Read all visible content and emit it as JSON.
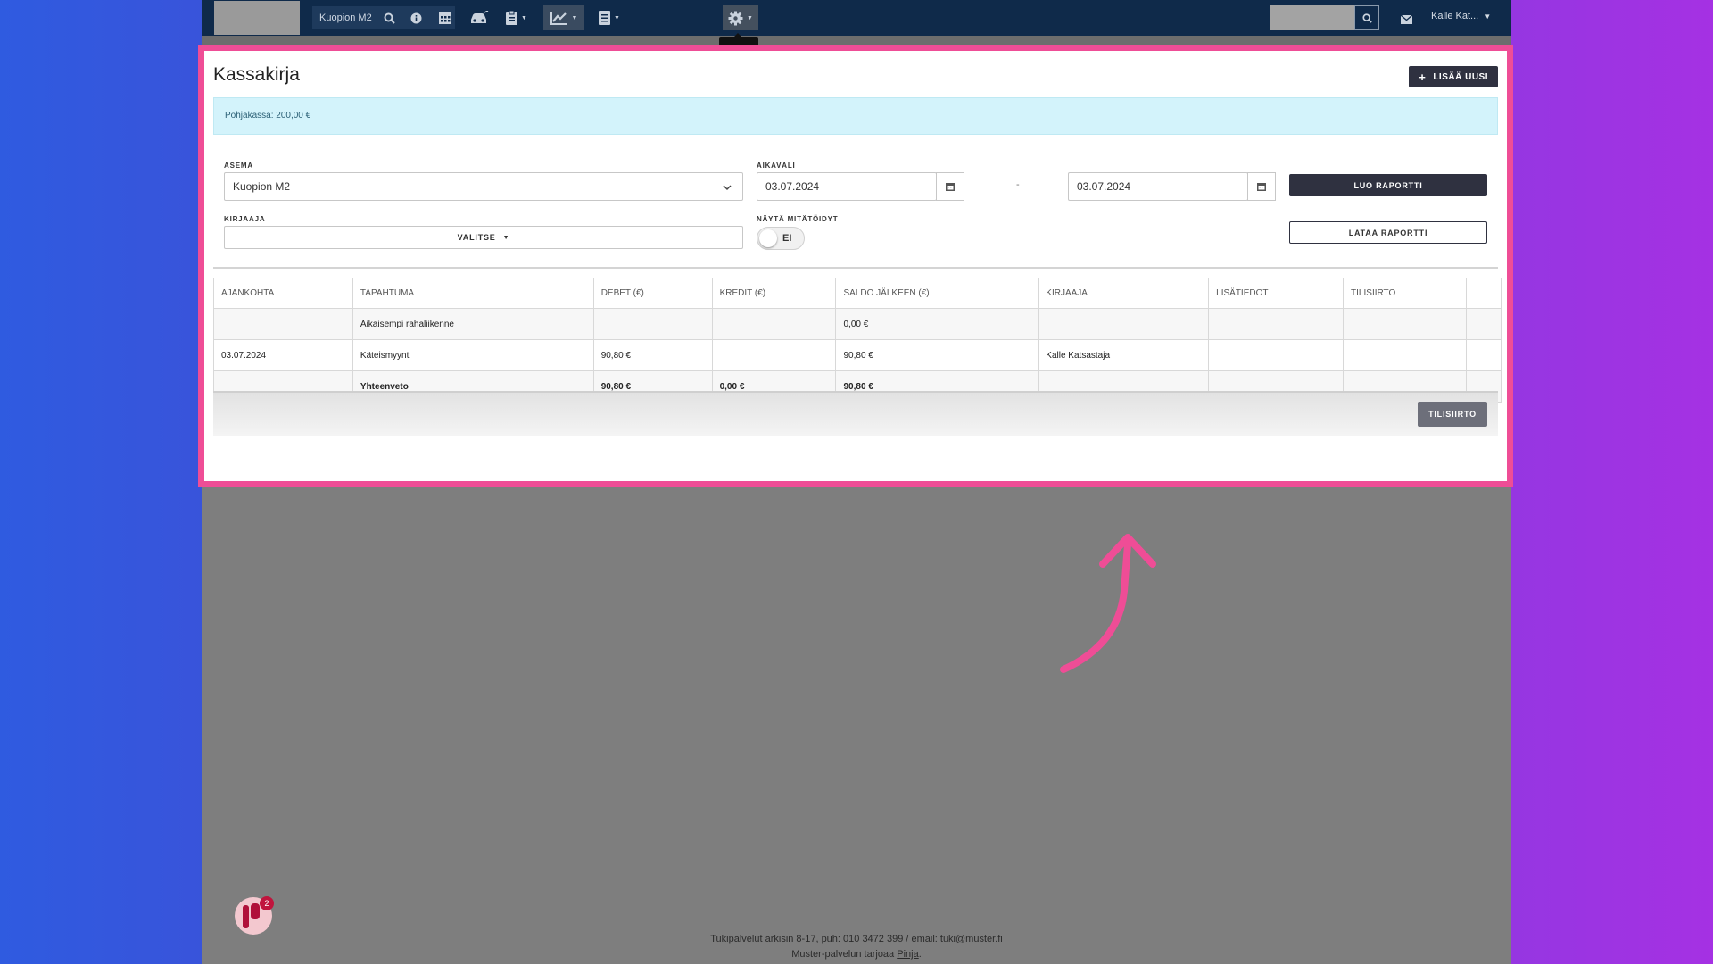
{
  "topbar": {
    "station": "Kuopion M2",
    "user": "Kalle Kat...",
    "icons": [
      "search-icon",
      "info-icon",
      "calendar-icon",
      "car-icon",
      "clipboard-icon",
      "chart-icon",
      "document-icon",
      "gear-icon",
      "mail-icon"
    ]
  },
  "page": {
    "title": "Kassakirja",
    "add_button": "LISÄÄ UUSI",
    "info": "Pohjakassa: 200,00 €"
  },
  "filters": {
    "station_label": "ASEMA",
    "station_value": "Kuopion M2",
    "period_label": "AIKAVÄLI",
    "date_from": "03.07.2024",
    "date_separator": "-",
    "date_to": "03.07.2024",
    "create_report": "LUO RAPORTTI",
    "download_report": "LATAA RAPORTTI",
    "recorder_label": "KIRJAAJA",
    "recorder_value": "VALITSE",
    "show_voided_label": "NÄYTÄ MITÄTÖIDYT",
    "show_voided_value": "EI"
  },
  "table": {
    "headers": [
      "AJANKOHTA",
      "TAPAHTUMA",
      "DEBET (€)",
      "KREDIT (€)",
      "SALDO JÄLKEEN (€)",
      "KIRJAAJA",
      "LISÄTIEDOT",
      "TILISIIRTO",
      ""
    ],
    "rows": [
      [
        "",
        "Aikaisempi rahaliikenne",
        "",
        "",
        "0,00 €",
        "",
        "",
        "",
        ""
      ],
      [
        "03.07.2024",
        "Käteismyynti",
        "90,80 €",
        "",
        "90,80 €",
        "Kalle Katsastaja",
        "",
        "",
        ""
      ],
      [
        "",
        "Yhteenveto",
        "90,80 €",
        "0,00 €",
        "90,80 €",
        "",
        "",
        "",
        ""
      ]
    ]
  },
  "transfer_button": "TILISIIRTO",
  "chat_badge": "2",
  "footer": {
    "line1": "Tukipalvelut arkisin 8-17, puh: 010 3472 399 / email: tuki@muster.fi",
    "line2_prefix": "Muster-palvelun tarjoaa ",
    "line2_link": "Pinja",
    "line2_suffix": "."
  },
  "colors": {
    "highlight": "#ef4d96",
    "navbar": "#0f2a4a",
    "button_dark": "#2f3140",
    "info_bg": "#d3f3fb"
  }
}
